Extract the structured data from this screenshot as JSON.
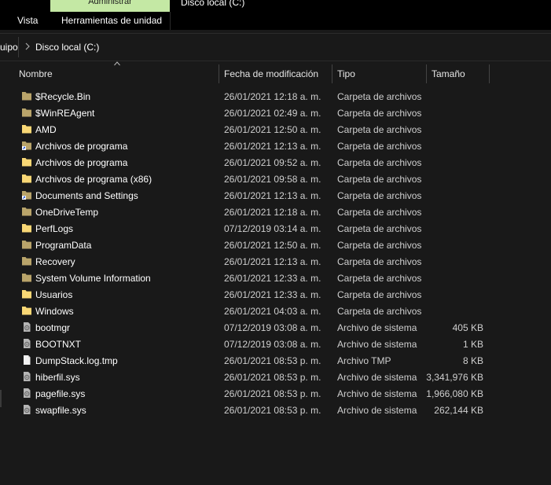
{
  "ribbon": {
    "context_tab": "Administrar",
    "window_title": "Disco local (C:)",
    "tabs": [
      "Vista",
      "Herramientas de unidad"
    ]
  },
  "address": {
    "crumbs": [
      "uipo",
      "Disco local (C:)"
    ]
  },
  "columns": {
    "name": "Nombre",
    "date": "Fecha de modificación",
    "type": "Tipo",
    "size": "Tamaño"
  },
  "files": [
    {
      "name": "$Recycle.Bin",
      "date": "26/01/2021 12:18 a. m.",
      "type": "Carpeta de archivos",
      "size": "",
      "icon": "folder-hidden-icon"
    },
    {
      "name": "$WinREAgent",
      "date": "26/01/2021 02:49 a. m.",
      "type": "Carpeta de archivos",
      "size": "",
      "icon": "folder-hidden-icon"
    },
    {
      "name": "AMD",
      "date": "26/01/2021 12:50 a. m.",
      "type": "Carpeta de archivos",
      "size": "",
      "icon": "folder-icon"
    },
    {
      "name": "Archivos de programa",
      "date": "26/01/2021 12:13 a. m.",
      "type": "Carpeta de archivos",
      "size": "",
      "icon": "folder-shortcut-icon"
    },
    {
      "name": "Archivos de programa",
      "date": "26/01/2021 09:52 a. m.",
      "type": "Carpeta de archivos",
      "size": "",
      "icon": "folder-icon"
    },
    {
      "name": "Archivos de programa (x86)",
      "date": "26/01/2021 09:58 a. m.",
      "type": "Carpeta de archivos",
      "size": "",
      "icon": "folder-icon"
    },
    {
      "name": "Documents and Settings",
      "date": "26/01/2021 12:13 a. m.",
      "type": "Carpeta de archivos",
      "size": "",
      "icon": "folder-shortcut-icon"
    },
    {
      "name": "OneDriveTemp",
      "date": "26/01/2021 12:18 a. m.",
      "type": "Carpeta de archivos",
      "size": "",
      "icon": "folder-hidden-icon"
    },
    {
      "name": "PerfLogs",
      "date": "07/12/2019 03:14 a. m.",
      "type": "Carpeta de archivos",
      "size": "",
      "icon": "folder-icon"
    },
    {
      "name": "ProgramData",
      "date": "26/01/2021 12:50 a. m.",
      "type": "Carpeta de archivos",
      "size": "",
      "icon": "folder-hidden-icon"
    },
    {
      "name": "Recovery",
      "date": "26/01/2021 12:13 a. m.",
      "type": "Carpeta de archivos",
      "size": "",
      "icon": "folder-hidden-icon"
    },
    {
      "name": "System Volume Information",
      "date": "26/01/2021 12:33 a. m.",
      "type": "Carpeta de archivos",
      "size": "",
      "icon": "folder-hidden-icon"
    },
    {
      "name": "Usuarios",
      "date": "26/01/2021 12:33 a. m.",
      "type": "Carpeta de archivos",
      "size": "",
      "icon": "folder-icon"
    },
    {
      "name": "Windows",
      "date": "26/01/2021 04:03 a. m.",
      "type": "Carpeta de archivos",
      "size": "",
      "icon": "folder-icon"
    },
    {
      "name": "bootmgr",
      "date": "07/12/2019 03:08 a. m.",
      "type": "Archivo de sistema",
      "size": "405 KB",
      "icon": "system-file-icon"
    },
    {
      "name": "BOOTNXT",
      "date": "07/12/2019 03:08 a. m.",
      "type": "Archivo de sistema",
      "size": "1 KB",
      "icon": "system-file-icon"
    },
    {
      "name": "DumpStack.log.tmp",
      "date": "26/01/2021 08:53 p. m.",
      "type": "Archivo TMP",
      "size": "8 KB",
      "icon": "file-icon"
    },
    {
      "name": "hiberfil.sys",
      "date": "26/01/2021 08:53 p. m.",
      "type": "Archivo de sistema",
      "size": "3,341,976 KB",
      "icon": "system-file-icon"
    },
    {
      "name": "pagefile.sys",
      "date": "26/01/2021 08:53 p. m.",
      "type": "Archivo de sistema",
      "size": "1,966,080 KB",
      "icon": "system-file-icon"
    },
    {
      "name": "swapfile.sys",
      "date": "26/01/2021 08:53 p. m.",
      "type": "Archivo de sistema",
      "size": "262,144 KB",
      "icon": "system-file-icon"
    }
  ],
  "colors": {
    "background": "#191919",
    "context_tab": "#c4e8a4",
    "folder": "#f8d775",
    "folder_hidden": "#b8a46a"
  }
}
